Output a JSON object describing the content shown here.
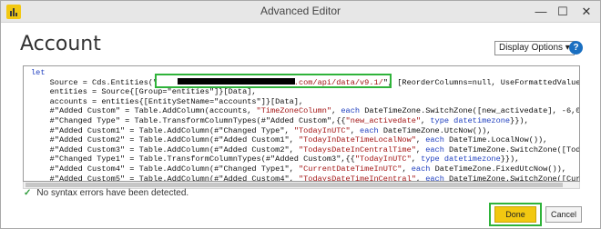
{
  "window": {
    "title": "Advanced Editor",
    "controls": {
      "minimize": "—",
      "maximize": "☐",
      "close": "✕"
    }
  },
  "page": {
    "heading": "Account",
    "display_options": "Display Options ▾",
    "help": "?"
  },
  "editor": {
    "lines": [
      [
        {
          "t": "let",
          "c": "kw"
        }
      ],
      [
        {
          "t": "    Source = Cds.Entities(\""
        },
        {
          "t": "                            s.com/api/data/v9.1/",
          "c": "str"
        },
        {
          "t": "\", [ReorderColumns=null, UseFormattedValue=null]),"
        }
      ],
      [
        {
          "t": "    entities = Source{[Group=\"entities\"]}[Data],"
        }
      ],
      [
        {
          "t": "    accounts = entities{[EntitySetName=\"accounts\"]}[Data],"
        }
      ],
      [
        {
          "t": "    #\"Added Custom\" = Table.AddColumn(accounts, "
        },
        {
          "t": "\"TimeZoneColumn\"",
          "c": "str"
        },
        {
          "t": ", "
        },
        {
          "t": "each",
          "c": "kw"
        },
        {
          "t": " DateTimeZone.SwitchZone([new_activedate], -6,00)),"
        }
      ],
      [
        {
          "t": "    #\"Changed Type\" = Table.TransformColumnTypes(#\"Added Custom\",{{"
        },
        {
          "t": "\"new_activedate\"",
          "c": "str"
        },
        {
          "t": ", "
        },
        {
          "t": "type datetimezone",
          "c": "kw"
        },
        {
          "t": "}}),"
        }
      ],
      [
        {
          "t": "    #\"Added Custom1\" = Table.AddColumn(#\"Changed Type\", "
        },
        {
          "t": "\"TodayInUTC\"",
          "c": "str"
        },
        {
          "t": ", "
        },
        {
          "t": "each",
          "c": "kw"
        },
        {
          "t": " DateTimeZone.UtcNow()),"
        }
      ],
      [
        {
          "t": "    #\"Added Custom2\" = Table.AddColumn(#\"Added Custom1\", "
        },
        {
          "t": "\"TodayInDateTimeLocalNow\"",
          "c": "str"
        },
        {
          "t": ", "
        },
        {
          "t": "each",
          "c": "kw"
        },
        {
          "t": " DateTime.LocalNow()),"
        }
      ],
      [
        {
          "t": "    #\"Added Custom3\" = Table.AddColumn(#\"Added Custom2\", "
        },
        {
          "t": "\"TodaysDateInCentralTime\"",
          "c": "str"
        },
        {
          "t": ", "
        },
        {
          "t": "each",
          "c": "kw"
        },
        {
          "t": " DateTimeZone.SwitchZone([TodayInUTC], -6, 00))"
        }
      ],
      [
        {
          "t": "    #\"Changed Type1\" = Table.TransformColumnTypes(#\"Added Custom3\",{{"
        },
        {
          "t": "\"TodayInUTC\"",
          "c": "str"
        },
        {
          "t": ", "
        },
        {
          "t": "type datetimezone",
          "c": "kw"
        },
        {
          "t": "}}),"
        }
      ],
      [
        {
          "t": "    #\"Added Custom4\" = Table.AddColumn(#\"Changed Type1\", "
        },
        {
          "t": "\"CurrentDateTimeInUTC\"",
          "c": "str"
        },
        {
          "t": ", "
        },
        {
          "t": "each",
          "c": "kw"
        },
        {
          "t": " DateTimeZone.FixedUtcNow()),"
        }
      ],
      [
        {
          "t": "    #\"Added Custom5\" = Table.AddColumn(#\"Added Custom4\", "
        },
        {
          "t": "\"TodaysDateTimeInCentral\"",
          "c": "str"
        },
        {
          "t": ", "
        },
        {
          "t": "each",
          "c": "kw"
        },
        {
          "t": " DateTimeZone.SwitchZone([CurrentDateTimeInUTC]"
        }
      ]
    ]
  },
  "status": {
    "message": "No syntax errors have been detected."
  },
  "footer": {
    "done_label": "Done",
    "cancel_label": "Cancel"
  }
}
